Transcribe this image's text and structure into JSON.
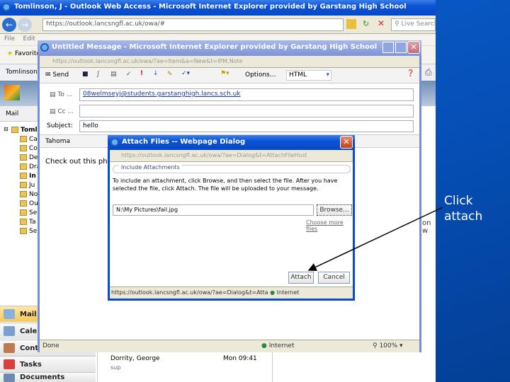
{
  "outer_window": {
    "title": "Tomlinson, J - Outlook Web Access - Microsoft Internet Explorer provided by Garstang High School",
    "address": "https://outlook.lancsngfl.ac.uk/owa/#",
    "search_placeholder": "Live Search",
    "menu": [
      "File",
      "Edit"
    ],
    "favorites_label": "Favorites",
    "tab_label": "Tomlinson",
    "mail_header": "Mail",
    "folders": [
      {
        "label": "Tomli",
        "bold": false
      },
      {
        "label": "Ca"
      },
      {
        "label": "Co"
      },
      {
        "label": "De"
      },
      {
        "label": "Dra"
      },
      {
        "label": "In",
        "bold": true
      },
      {
        "label": "Ju"
      },
      {
        "label": "No"
      },
      {
        "label": "Ou"
      },
      {
        "label": "Se"
      },
      {
        "label": "Ta"
      },
      {
        "label": "Se"
      }
    ],
    "nav": [
      "Mail",
      "Calendar",
      "Contacts",
      "Tasks",
      "Documents"
    ],
    "message": {
      "sender": "Dorrity, George",
      "time": "Mon 09:41",
      "subject": "sup"
    },
    "partial_text": "on w"
  },
  "compose_window": {
    "title": "Untitled Message - Microsoft Internet Explorer provided by Garstang High School",
    "address": "https://outlook.lancsngfl.ac.uk/owa/?ae=Item&a=New&t=IPM.Note",
    "toolbar": {
      "send": "Send",
      "options": "Options...",
      "format": "HTML"
    },
    "to_label": "To ...",
    "to_value": "08welmseyj@students.garstanghigh.lancs.sch.uk",
    "cc_label": "Cc ...",
    "cc_value": "",
    "subject_label": "Subject:",
    "subject_value": "hello",
    "font": "Tahoma",
    "body": "Check out this photo",
    "status": {
      "left": "Done",
      "zone": "Internet",
      "zoom": "100%"
    }
  },
  "dialog": {
    "title": "Attach Files -- Webpage Dialog",
    "address": "https://outlook.lancsngfl.ac.uk/owa/?ae=Dialog&t=AttachFileHost",
    "group_label": "Include Attachments",
    "instructions": "To include an attachment, click Browse, and then select the file. After you have selected the file, click Attach. The file will be uploaded to your message.",
    "file_path": "N:\\My Pictures\\fail.jpg",
    "browse": "Browse...",
    "choose_more": "Choose more files",
    "attach": "Attach",
    "cancel": "Cancel",
    "status_url": "https://outlook.lancsngfl.ac.uk/owa/?ae=Dialog&t=Atta",
    "status_zone": "Internet"
  },
  "annotation": {
    "line1": "Click",
    "line2": "attach"
  }
}
